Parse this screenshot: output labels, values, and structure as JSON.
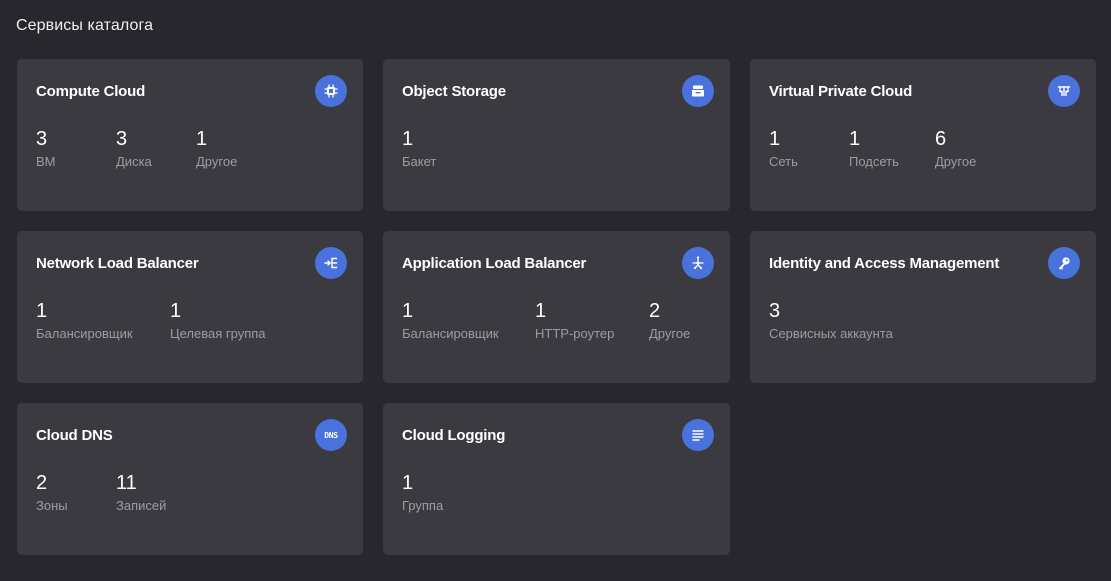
{
  "section_title": "Сервисы каталога",
  "colors": {
    "background": "#28272d",
    "card": "#3b3a40",
    "icon_bg": "#4a72dc",
    "label": "#9d9ca2"
  },
  "cards": [
    {
      "title": "Compute Cloud",
      "icon": "cpu-icon",
      "stats": [
        {
          "value": "3",
          "label": "ВМ"
        },
        {
          "value": "3",
          "label": "Диска"
        },
        {
          "value": "1",
          "label": "Другое"
        }
      ]
    },
    {
      "title": "Object Storage",
      "icon": "storage-icon",
      "stats": [
        {
          "value": "1",
          "label": "Бакет"
        }
      ]
    },
    {
      "title": "Virtual Private Cloud",
      "icon": "network-icon",
      "stats": [
        {
          "value": "1",
          "label": "Сеть"
        },
        {
          "value": "1",
          "label": "Подсеть"
        },
        {
          "value": "6",
          "label": "Другое"
        }
      ]
    },
    {
      "title": "Network Load Balancer",
      "icon": "balancer-icon",
      "stats": [
        {
          "value": "1",
          "label": "Балансировщик"
        },
        {
          "value": "1",
          "label": "Целевая группа"
        }
      ]
    },
    {
      "title": "Application Load Balancer",
      "icon": "app-balancer-icon",
      "stats": [
        {
          "value": "1",
          "label": "Балансировщик"
        },
        {
          "value": "1",
          "label": "HTTP-роутер"
        },
        {
          "value": "2",
          "label": "Другое"
        }
      ]
    },
    {
      "title": "Identity and Access Management",
      "icon": "key-icon",
      "stats": [
        {
          "value": "3",
          "label": "Сервисных аккаунта"
        }
      ]
    },
    {
      "title": "Cloud DNS",
      "icon": "dns-icon",
      "icon_text": "DNS",
      "stats": [
        {
          "value": "2",
          "label": "Зоны"
        },
        {
          "value": "11",
          "label": "Записей"
        }
      ]
    },
    {
      "title": "Cloud Logging",
      "icon": "log-icon",
      "stats": [
        {
          "value": "1",
          "label": "Группа"
        }
      ]
    }
  ]
}
